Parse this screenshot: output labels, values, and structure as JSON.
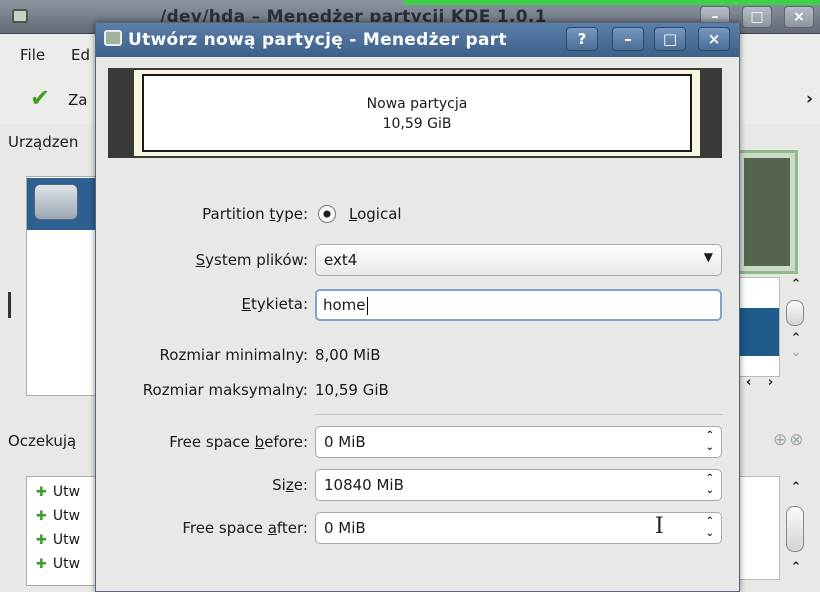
{
  "main_window": {
    "title": "/dev/hda – Menedżer partycji KDE 1.0.1",
    "menu": [
      "File",
      "Ed"
    ],
    "toolbar_apply_label": "Za",
    "devices_label": "Urządzen",
    "pending_label": "Oczekują",
    "pending_items": [
      "Utw",
      "Utw",
      "Utw",
      "Utw"
    ],
    "window_buttons": [
      "–",
      "□",
      "×"
    ]
  },
  "dialog": {
    "title": "Utwórz nową partycję - Menedżer part",
    "title_buttons": [
      "?",
      "–",
      "□",
      "×"
    ],
    "preview": {
      "name": "Nowa partycja",
      "size": "10,59 GiB"
    },
    "partition_type": {
      "label": "Partition type:",
      "value": "Logical"
    },
    "filesystem": {
      "label": "System plików:",
      "value": "ext4"
    },
    "label_field": {
      "label": "Etykieta:",
      "value": "home"
    },
    "min_size": {
      "label": "Rozmiar minimalny:",
      "value": "8,00 MiB"
    },
    "max_size": {
      "label": "Rozmiar maksymalny:",
      "value": "10,59 GiB"
    },
    "free_before": {
      "label": "Free space before:",
      "value": "0 MiB"
    },
    "size": {
      "label": "Size:",
      "value": "10840 MiB"
    },
    "free_after": {
      "label": "Free space after:",
      "value": "0 MiB"
    }
  },
  "colors": {
    "dialog_title_bg": "#4a6d97",
    "selection_blue": "#2e5f93",
    "focus_border": "#7ea2cf"
  }
}
